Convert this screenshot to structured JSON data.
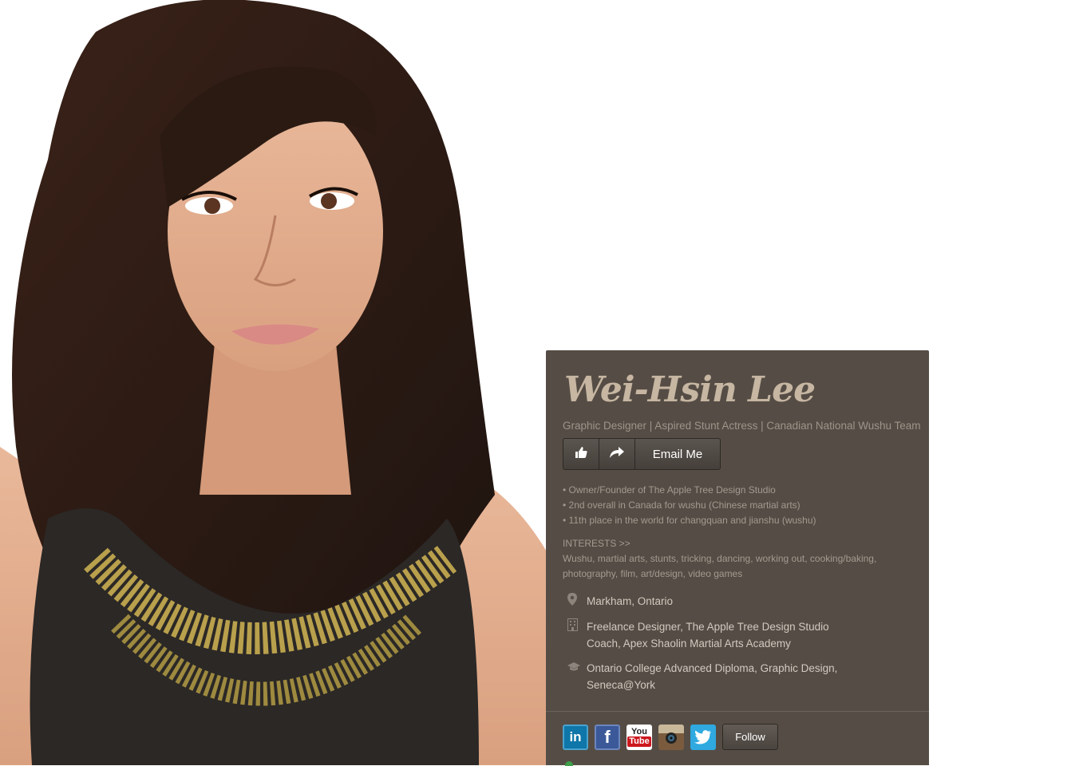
{
  "profile": {
    "name": "Wei-Hsin Lee",
    "tagline": "Graphic Designer | Aspired Stunt Actress | Canadian National Wushu Team",
    "email_label": "Email Me",
    "bullets": [
      "• Owner/Founder of The Apple Tree Design Studio",
      "• 2nd overall in Canada for wushu (Chinese martial arts)",
      "• 11th place in the world for changquan and jianshu (wushu)"
    ],
    "interests_heading": "INTERESTS >>",
    "interests_text": "Wushu, martial arts, stunts, tricking, dancing, working out, cooking/baking, photography, film, art/design, video games",
    "location": "Markham, Ontario",
    "work": [
      "Freelance Designer, The Apple Tree Design Studio",
      "Coach, Apex Shaolin Martial Arts Academy"
    ],
    "education": [
      "Ontario College Advanced Diploma, Graphic Design,",
      "Seneca@York"
    ]
  },
  "social": {
    "icons": [
      "linkedin-icon",
      "facebook-icon",
      "youtube-icon",
      "instagram-icon",
      "twitter-icon"
    ],
    "linkedin_text": "in",
    "facebook_text": "f",
    "youtube_text_top": "You",
    "youtube_text_bottom": "Tube",
    "follow_label": "Follow"
  },
  "colors": {
    "card_bg": "#554d45",
    "name": "#c6b6a2",
    "linkedin": "#0e76a8",
    "facebook": "#3b5998",
    "youtube": "#cc181e",
    "twitter": "#2fa9e0"
  }
}
